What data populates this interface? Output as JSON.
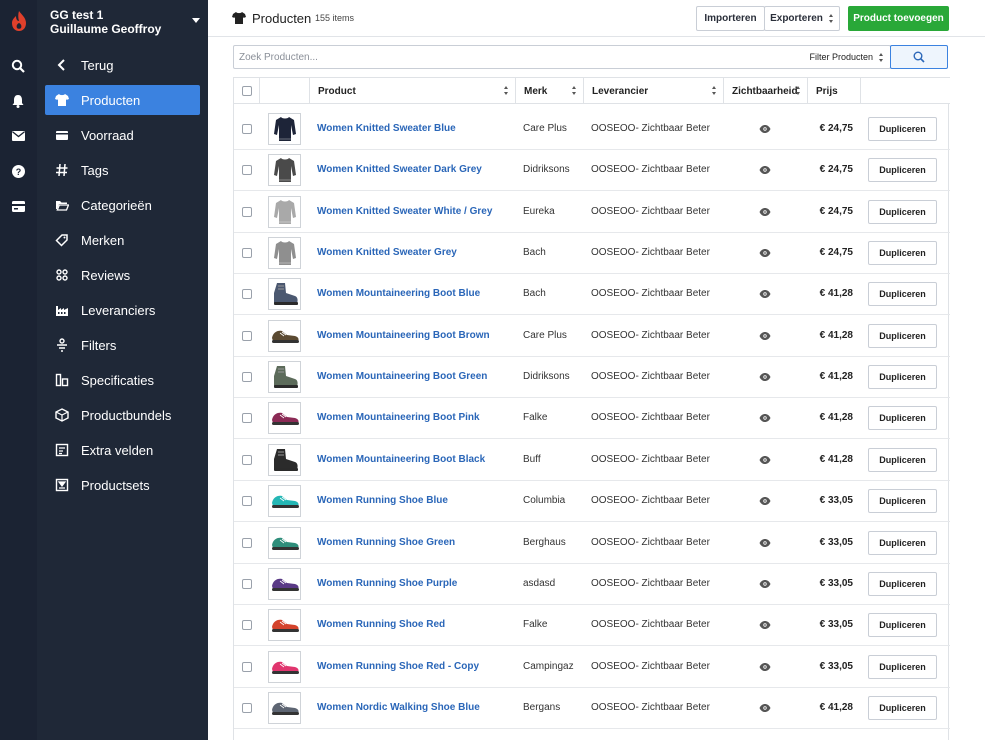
{
  "account": {
    "store": "GG test 1",
    "user": "Guillaume Geoffroy"
  },
  "rail": {
    "icons": [
      "logo-icon",
      "search-icon",
      "bell-icon",
      "mail-icon",
      "help-icon",
      "card-icon"
    ]
  },
  "sidebar": {
    "items": [
      {
        "label": "Terug",
        "icon": "chevron-left-icon",
        "active": false
      },
      {
        "label": "Producten",
        "icon": "tshirt-icon",
        "active": true
      },
      {
        "label": "Voorraad",
        "icon": "inventory-icon",
        "active": false
      },
      {
        "label": "Tags",
        "icon": "hash-icon",
        "active": false
      },
      {
        "label": "Categorieën",
        "icon": "folder-icon",
        "active": false
      },
      {
        "label": "Merken",
        "icon": "tag-icon",
        "active": false
      },
      {
        "label": "Reviews",
        "icon": "reviews-icon",
        "active": false
      },
      {
        "label": "Leveranciers",
        "icon": "factory-icon",
        "active": false
      },
      {
        "label": "Filters",
        "icon": "filter-icon",
        "active": false
      },
      {
        "label": "Specificaties",
        "icon": "specs-icon",
        "active": false
      },
      {
        "label": "Productbundels",
        "icon": "bundle-icon",
        "active": false
      },
      {
        "label": "Extra velden",
        "icon": "fields-icon",
        "active": false
      },
      {
        "label": "Productsets",
        "icon": "sets-icon",
        "active": false
      }
    ]
  },
  "header": {
    "title": "Producten",
    "count": "155 items",
    "import_label": "Importeren",
    "export_label": "Exporteren",
    "add_label": "Product toevoegen"
  },
  "search": {
    "placeholder": "Zoek Producten...",
    "filter_label": "Filter Producten"
  },
  "table": {
    "columns": {
      "product": "Product",
      "brand": "Merk",
      "supplier": "Leverancier",
      "visibility": "Zichtbaarheid",
      "price": "Prijs"
    },
    "duplicate_label": "Dupliceren",
    "rows": [
      {
        "name": "Women Knitted Sweater Blue",
        "brand": "Care Plus",
        "supplier": "OOSEOO- Zichtbaar Beter",
        "price": "€ 24,75",
        "kind": "sweater",
        "color": "#1d2438"
      },
      {
        "name": "Women Knitted Sweater Dark Grey",
        "brand": "Didriksons",
        "supplier": "OOSEOO- Zichtbaar Beter",
        "price": "€ 24,75",
        "kind": "sweater",
        "color": "#4a4a4a"
      },
      {
        "name": "Women Knitted Sweater White / Grey",
        "brand": "Eureka",
        "supplier": "OOSEOO- Zichtbaar Beter",
        "price": "€ 24,75",
        "kind": "sweater",
        "color": "#a9a9a9"
      },
      {
        "name": "Women Knitted Sweater Grey",
        "brand": "Bach",
        "supplier": "OOSEOO- Zichtbaar Beter",
        "price": "€ 24,75",
        "kind": "sweater",
        "color": "#8f8f8f"
      },
      {
        "name": "Women Mountaineering Boot Blue",
        "brand": "Bach",
        "supplier": "OOSEOO- Zichtbaar Beter",
        "price": "€ 41,28",
        "kind": "boot",
        "color": "#4b5870"
      },
      {
        "name": "Women Mountaineering Boot Brown",
        "brand": "Care Plus",
        "supplier": "OOSEOO- Zichtbaar Beter",
        "price": "€ 41,28",
        "kind": "shoe",
        "color": "#5b4a32"
      },
      {
        "name": "Women Mountaineering Boot Green",
        "brand": "Didriksons",
        "supplier": "OOSEOO- Zichtbaar Beter",
        "price": "€ 41,28",
        "kind": "boot",
        "color": "#5c6b5a"
      },
      {
        "name": "Women Mountaineering Boot Pink",
        "brand": "Falke",
        "supplier": "OOSEOO- Zichtbaar Beter",
        "price": "€ 41,28",
        "kind": "shoe",
        "color": "#8b2a55"
      },
      {
        "name": "Women Mountaineering Boot Black",
        "brand": "Buff",
        "supplier": "OOSEOO- Zichtbaar Beter",
        "price": "€ 41,28",
        "kind": "boot",
        "color": "#2b2b2b"
      },
      {
        "name": "Women Running Shoe Blue",
        "brand": "Columbia",
        "supplier": "OOSEOO- Zichtbaar Beter",
        "price": "€ 33,05",
        "kind": "shoe",
        "color": "#25b7b5"
      },
      {
        "name": "Women Running Shoe Green",
        "brand": "Berghaus",
        "supplier": "OOSEOO- Zichtbaar Beter",
        "price": "€ 33,05",
        "kind": "shoe",
        "color": "#2f8e7b"
      },
      {
        "name": "Women Running Shoe Purple",
        "brand": "asdasd",
        "supplier": "OOSEOO- Zichtbaar Beter",
        "price": "€ 33,05",
        "kind": "shoe",
        "color": "#5a3a86"
      },
      {
        "name": "Women Running Shoe Red",
        "brand": "Falke",
        "supplier": "OOSEOO- Zichtbaar Beter",
        "price": "€ 33,05",
        "kind": "shoe",
        "color": "#d4432c"
      },
      {
        "name": "Women Running Shoe Red - Copy",
        "brand": "Campingaz",
        "supplier": "OOSEOO- Zichtbaar Beter",
        "price": "€ 33,05",
        "kind": "shoe",
        "color": "#e0356e"
      },
      {
        "name": "Women Nordic Walking Shoe Blue",
        "brand": "Bergans",
        "supplier": "OOSEOO- Zichtbaar Beter",
        "price": "€ 41,28",
        "kind": "shoe",
        "color": "#5d6572"
      }
    ]
  },
  "colors": {
    "sidebar": "#1f2837",
    "rail": "#1b2333",
    "accent": "#3b82e0",
    "primary_button": "#29a838",
    "link": "#2a66b8"
  }
}
